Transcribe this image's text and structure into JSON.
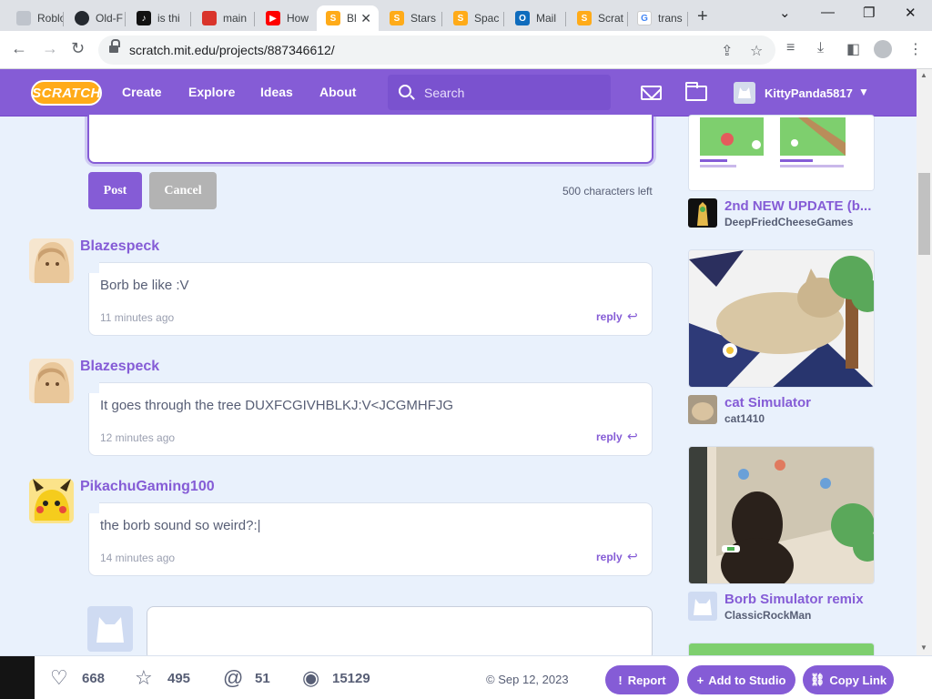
{
  "browser": {
    "tabs": [
      {
        "label": "Roblo",
        "favcolor": "#bfc4cc"
      },
      {
        "label": "Old-F",
        "favcolor": "#24292f"
      },
      {
        "label": "is thi",
        "favcolor": "#111111"
      },
      {
        "label": "main",
        "favcolor": "#d9342b"
      },
      {
        "label": "How",
        "favcolor": "#ff0000"
      },
      {
        "label": "Bl",
        "favcolor": "#ffab19",
        "active": true
      },
      {
        "label": "Stars",
        "favcolor": "#ffab19"
      },
      {
        "label": "Spac",
        "favcolor": "#ffab19"
      },
      {
        "label": "Mail",
        "favcolor": "#0f6cbd"
      },
      {
        "label": "Scrat",
        "favcolor": "#ffab19"
      },
      {
        "label": "trans",
        "favcolor": "#4285f4"
      }
    ],
    "url": "scratch.mit.edu/projects/887346612/"
  },
  "nav": {
    "logo": "SCRATCH",
    "links": [
      "Create",
      "Explore",
      "Ideas",
      "About"
    ],
    "search_placeholder": "Search",
    "username": "KittyPanda5817"
  },
  "composer": {
    "post_label": "Post",
    "cancel_label": "Cancel",
    "chars_left": "500 characters left"
  },
  "comments": [
    {
      "user": "Blazespeck",
      "text": "Borb be like :V",
      "time": "11 minutes ago",
      "reply": "reply"
    },
    {
      "user": "Blazespeck",
      "text": "It goes through the tree DUXFCGIVHBLKJ:V<JCGMHFJG",
      "time": "12 minutes ago",
      "reply": "reply"
    },
    {
      "user": "PikachuGaming100",
      "text": "the borb sound so weird?:|",
      "time": "14 minutes ago",
      "reply": "reply"
    }
  ],
  "remixes": [
    {
      "title": "2nd NEW UPDATE (b...",
      "author": "DeepFriedCheeseGames"
    },
    {
      "title": "cat Simulator",
      "author": "cat1410"
    },
    {
      "title": "Borb Simulator remix",
      "author": "ClassicRockMan"
    }
  ],
  "stats": {
    "loves": "668",
    "favorites": "495",
    "remixes": "51",
    "views": "15129",
    "date": "Sep 12, 2023",
    "report_label": "Report",
    "studio_label": "Add to Studio",
    "copy_label": "Copy Link"
  },
  "colors": {
    "accent": "#855cd6",
    "background": "#e9f1fc",
    "logo": "#ffab19"
  }
}
